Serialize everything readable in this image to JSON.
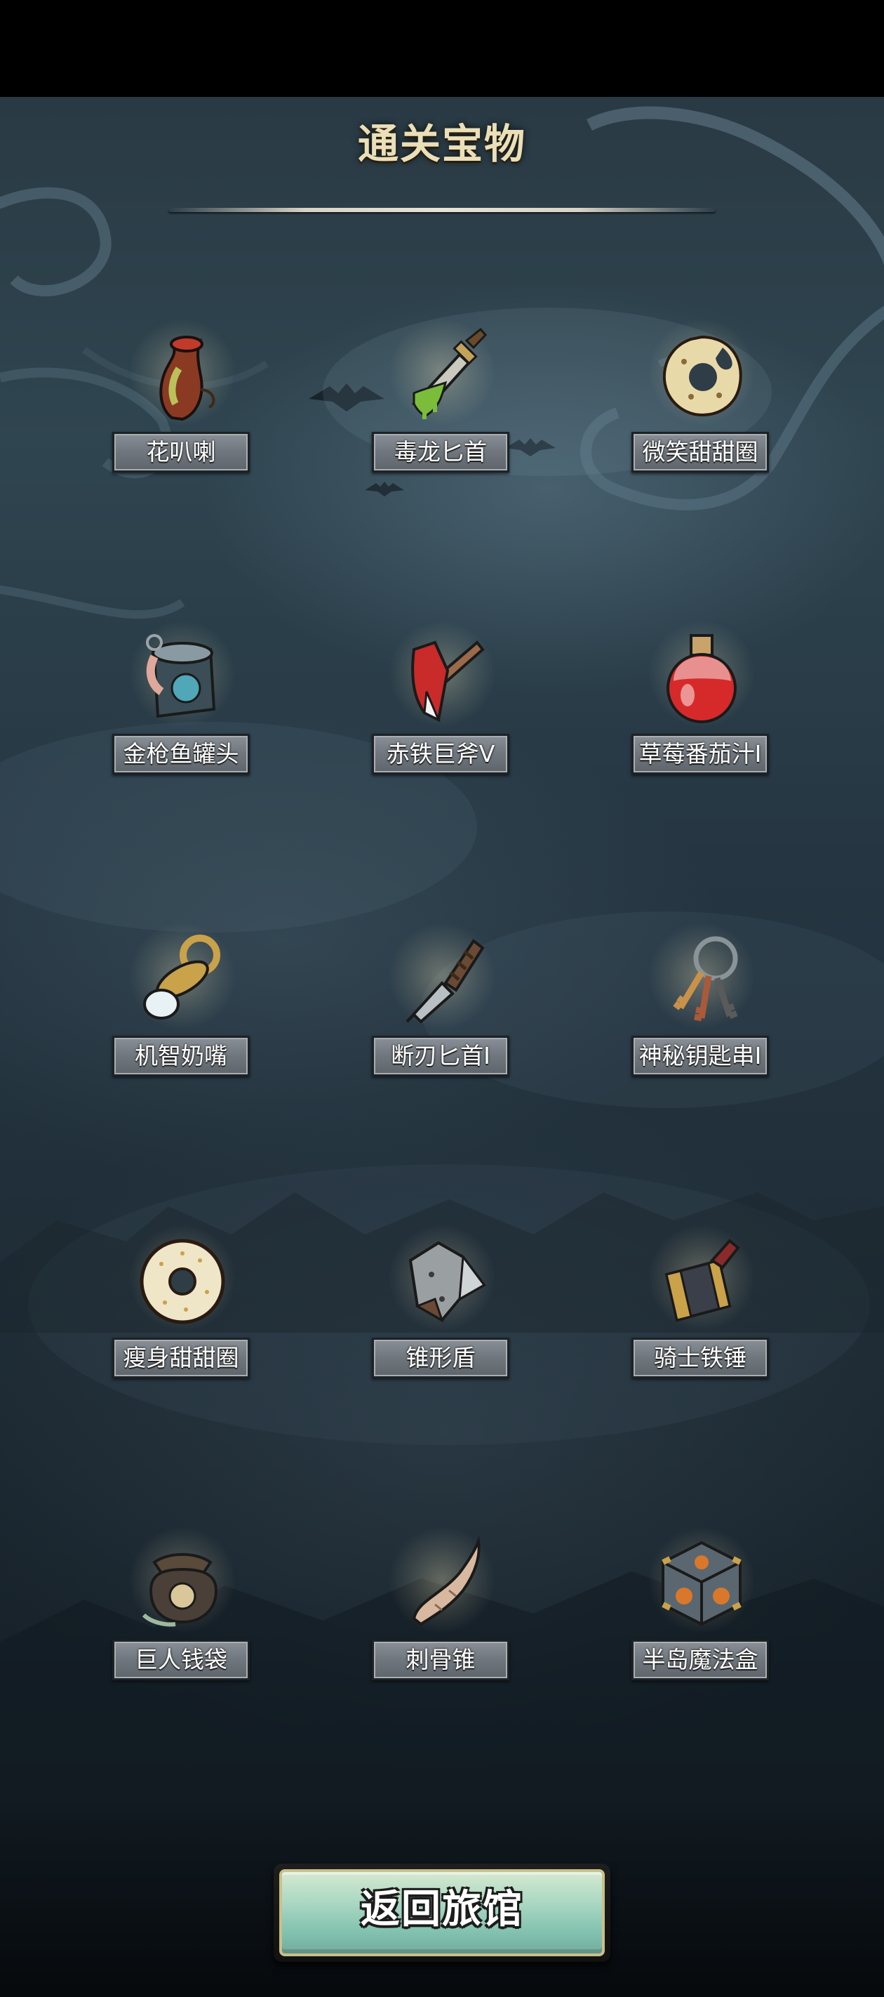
{
  "header": {
    "title": "通关宝物"
  },
  "items": [
    {
      "name": "花叭喇",
      "icon": "pitcher-plant-icon"
    },
    {
      "name": "毒龙匕首",
      "icon": "poison-dagger-icon"
    },
    {
      "name": "微笑甜甜圈",
      "icon": "bitten-donut-icon"
    },
    {
      "name": "金枪鱼罐头",
      "icon": "tuna-can-icon"
    },
    {
      "name": "赤铁巨斧V",
      "icon": "red-axe-icon"
    },
    {
      "name": "草莓番茄汁I",
      "icon": "red-potion-icon"
    },
    {
      "name": "机智奶嘴",
      "icon": "pacifier-icon"
    },
    {
      "name": "断刃匕首I",
      "icon": "broken-dagger-icon"
    },
    {
      "name": "神秘钥匙串I",
      "icon": "key-ring-icon"
    },
    {
      "name": "瘦身甜甜圈",
      "icon": "sprinkle-donut-icon"
    },
    {
      "name": "锥形盾",
      "icon": "spiked-shield-icon"
    },
    {
      "name": "骑士铁锤",
      "icon": "knight-hammer-icon"
    },
    {
      "name": "巨人钱袋",
      "icon": "money-bag-icon"
    },
    {
      "name": "刺骨锥",
      "icon": "bone-spike-icon"
    },
    {
      "name": "半岛魔法盒",
      "icon": "magic-cube-icon"
    }
  ],
  "footer": {
    "return_label": "返回旅馆"
  },
  "colors": {
    "title": "#eadfb6",
    "label_bg": "#6f767d",
    "button_bg": "#a8d6c2",
    "button_border": "#c9c08a"
  }
}
